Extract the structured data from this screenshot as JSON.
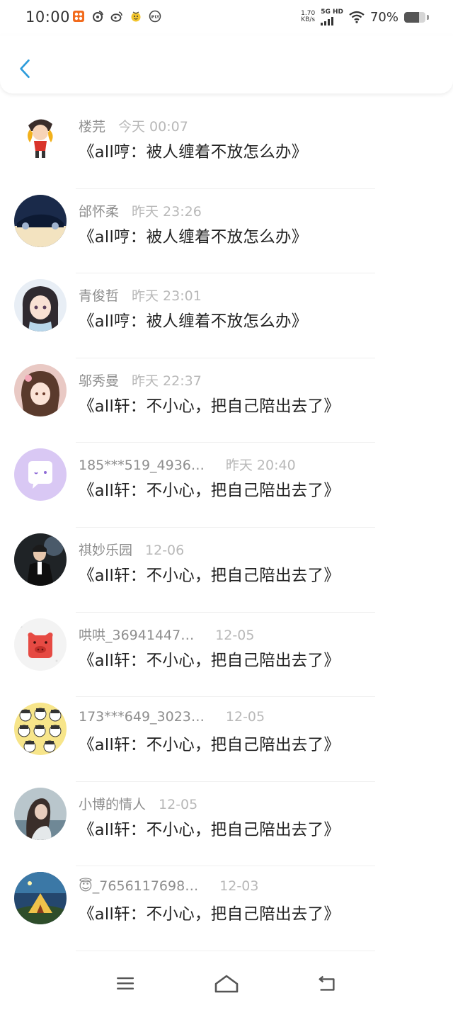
{
  "status_bar": {
    "time": "10:00",
    "speed_value": "1.70",
    "speed_unit": "KB/s",
    "network": "5G HD",
    "battery": "70%",
    "battery_level": 0.7,
    "notification_icons": [
      "app-icon",
      "weibo-icon",
      "weibo-icon",
      "emoji-icon",
      "ifly-icon"
    ]
  },
  "header": {
    "back_icon": "chevron-left-icon",
    "accent": "#2d9cdb"
  },
  "messages": [
    {
      "name": "楼芫",
      "time": "今天 00:07",
      "text": "《all哼：被人缠着不放怎么办》"
    },
    {
      "name": "邰怀柔",
      "time": "昨天 23:26",
      "text": "《all哼：被人缠着不放怎么办》"
    },
    {
      "name": "青俊哲",
      "time": "昨天 23:01",
      "text": "《all哼：被人缠着不放怎么办》"
    },
    {
      "name": "邬秀曼",
      "time": "昨天 22:37",
      "text": "《all轩：不小心，把自己陪出去了》"
    },
    {
      "name": "185***519_4936…",
      "time": "昨天 20:40",
      "text": "《all轩：不小心，把自己陪出去了》"
    },
    {
      "name": "祺妙乐园",
      "time": "12-06",
      "text": "《all轩：不小心，把自己陪出去了》"
    },
    {
      "name": "哄哄_36941447…",
      "time": "12-05",
      "text": "《all轩：不小心，把自己陪出去了》"
    },
    {
      "name": "173***649_3023…",
      "time": "12-05",
      "text": "《all轩：不小心，把自己陪出去了》"
    },
    {
      "name": "小博的情人",
      "time": "12-05",
      "text": "《all轩：不小心，把自己陪出去了》"
    },
    {
      "name": "😇_7656117698…",
      "time": "12-03",
      "text": "《all轩：不小心，把自己陪出去了》"
    }
  ],
  "nav": {
    "menu_icon": "menu-icon",
    "home_icon": "home-icon",
    "back_icon": "back-icon"
  }
}
